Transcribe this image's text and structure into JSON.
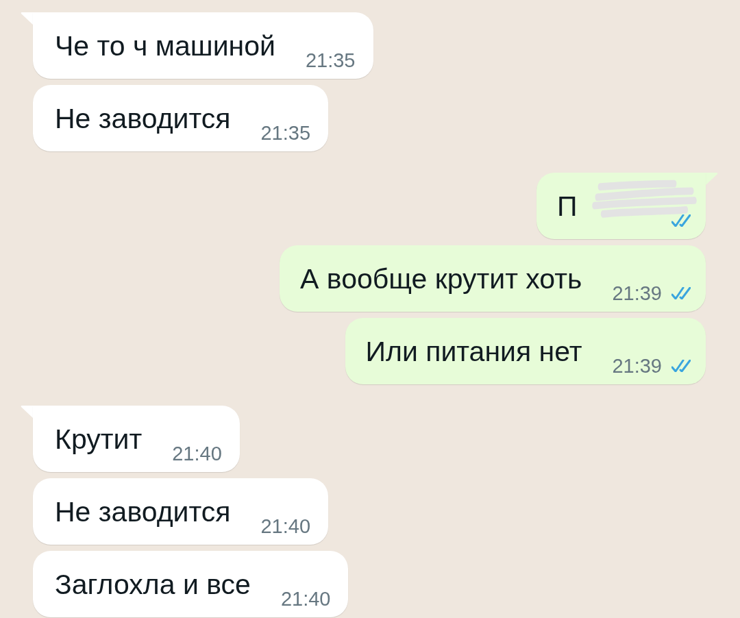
{
  "messages": [
    {
      "kind": "incoming",
      "tail": true,
      "text": "Че то ч машиной",
      "time": "21:35"
    },
    {
      "kind": "incoming",
      "tail": false,
      "text": "Не заводится",
      "time": "21:35"
    },
    {
      "kind": "outgoing",
      "tail": true,
      "redacted": true,
      "text": "П"
    },
    {
      "kind": "outgoing",
      "tail": false,
      "text": "А вообще крутит хоть",
      "time": "21:39"
    },
    {
      "kind": "outgoing",
      "tail": false,
      "text": "Или питания нет",
      "time": "21:39"
    },
    {
      "kind": "incoming",
      "tail": true,
      "text": "Крутит",
      "time": "21:40"
    },
    {
      "kind": "incoming",
      "tail": false,
      "text": "Не заводится",
      "time": "21:40"
    },
    {
      "kind": "incoming",
      "tail": false,
      "text": "Заглохла и все",
      "time": "21:40"
    }
  ]
}
